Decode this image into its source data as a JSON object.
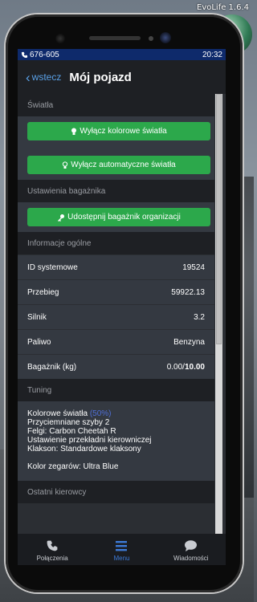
{
  "overlay": {
    "version": "EvoLife 1.6.4",
    "side_percent": "%"
  },
  "status_bar": {
    "phone_number": "676-605",
    "time": "20:32"
  },
  "header": {
    "back_label": "wstecz",
    "title": "Mój pojazd"
  },
  "sections": {
    "lights": {
      "title": "Światła",
      "buttons": [
        "Wyłącz kolorowe światła",
        "Wyłącz automatyczne światła"
      ]
    },
    "trunk": {
      "title": "Ustawienia bagażnika",
      "button": "Udostępnij bagażnik organizacji"
    },
    "general": {
      "title": "Informacje ogólne",
      "rows": [
        {
          "label": "ID systemowe",
          "value": "19524"
        },
        {
          "label": "Przebieg",
          "value": "59922.13"
        },
        {
          "label": "Silnik",
          "value": "3.2"
        },
        {
          "label": "Paliwo",
          "value": "Benzyna"
        },
        {
          "label": "Bagażnik (kg)",
          "value_used": "0.00/",
          "value_max": "10.00"
        }
      ]
    },
    "tuning": {
      "title": "Tuning",
      "colored_lights": "Kolorowe światła ",
      "colored_lights_percent": "(50%)",
      "lines": [
        "Przyciemniane szyby 2",
        "Felgi: Carbon Cheetah R",
        "Ustawienie przekładni kierowniczej",
        "Klakson: Standardowe klaksony"
      ],
      "gauges": "Kolor zegarów: Ultra Blue"
    },
    "drivers": {
      "title": "Ostatni kierowcy"
    }
  },
  "tabs": [
    {
      "label": "Połączenia",
      "icon": "phone-icon"
    },
    {
      "label": "Menu",
      "icon": "menu-icon",
      "active": true
    },
    {
      "label": "Wiadomości",
      "icon": "chat-icon"
    }
  ],
  "colors": {
    "accent_green": "#2ca84b",
    "status_blue": "#0e2a6b",
    "link_blue": "#5aa0e6"
  }
}
